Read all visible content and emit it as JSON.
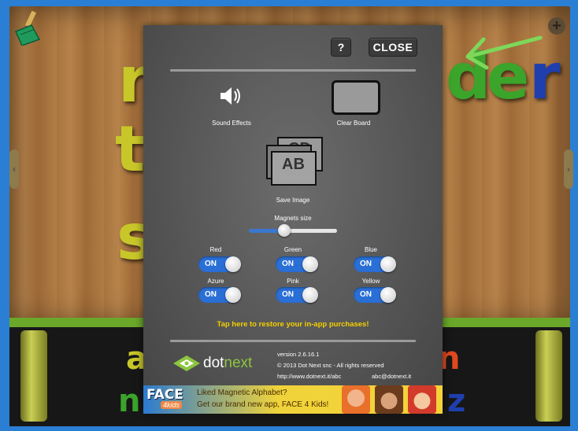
{
  "panel": {
    "help_label": "?",
    "close_label": "CLOSE",
    "sound_effects": "Sound Effects",
    "clear_board": "Clear Board",
    "save_image": "Save Image",
    "save_image_letters": {
      "front": "AB",
      "back": "CD"
    },
    "magnets_size_label": "Magnets size",
    "magnets_size_value": 0.4,
    "colors": [
      {
        "name": "Red",
        "state": "ON"
      },
      {
        "name": "Green",
        "state": "ON"
      },
      {
        "name": "Blue",
        "state": "ON"
      },
      {
        "name": "Azure",
        "state": "ON"
      },
      {
        "name": "Pink",
        "state": "ON"
      },
      {
        "name": "Yellow",
        "state": "ON"
      }
    ],
    "restore_text": "Tap here to restore your in-app purchases!",
    "logo_prefix": "dot",
    "logo_suffix": "next",
    "version": "version 2.6.16.1",
    "copyright": "© 2013 Dot Next snc - All rights reserved",
    "website": "http://www.dotnext.it/abc",
    "email": "abc@dotnext.it"
  },
  "ad": {
    "brand": "FACE",
    "brand_sub": "4kids",
    "line1": "Liked Magnetic Alphabet?",
    "line2": "Get our brand new app, FACE 4 Kids!"
  },
  "board_letters": {
    "top_right": [
      "d",
      "e",
      "r"
    ],
    "left_column": [
      "r",
      "t",
      "s"
    ],
    "tray_top": [
      "a",
      "n"
    ],
    "tray_bottom": [
      "n",
      "z"
    ],
    "corner_button": "+"
  },
  "colors": {
    "accent_blue": "#2a6fd6",
    "restore_yellow": "#f5d000",
    "letter_green": "#3aa52a",
    "letter_blue": "#1f3fae",
    "letter_yellow": "#c8c72a"
  }
}
